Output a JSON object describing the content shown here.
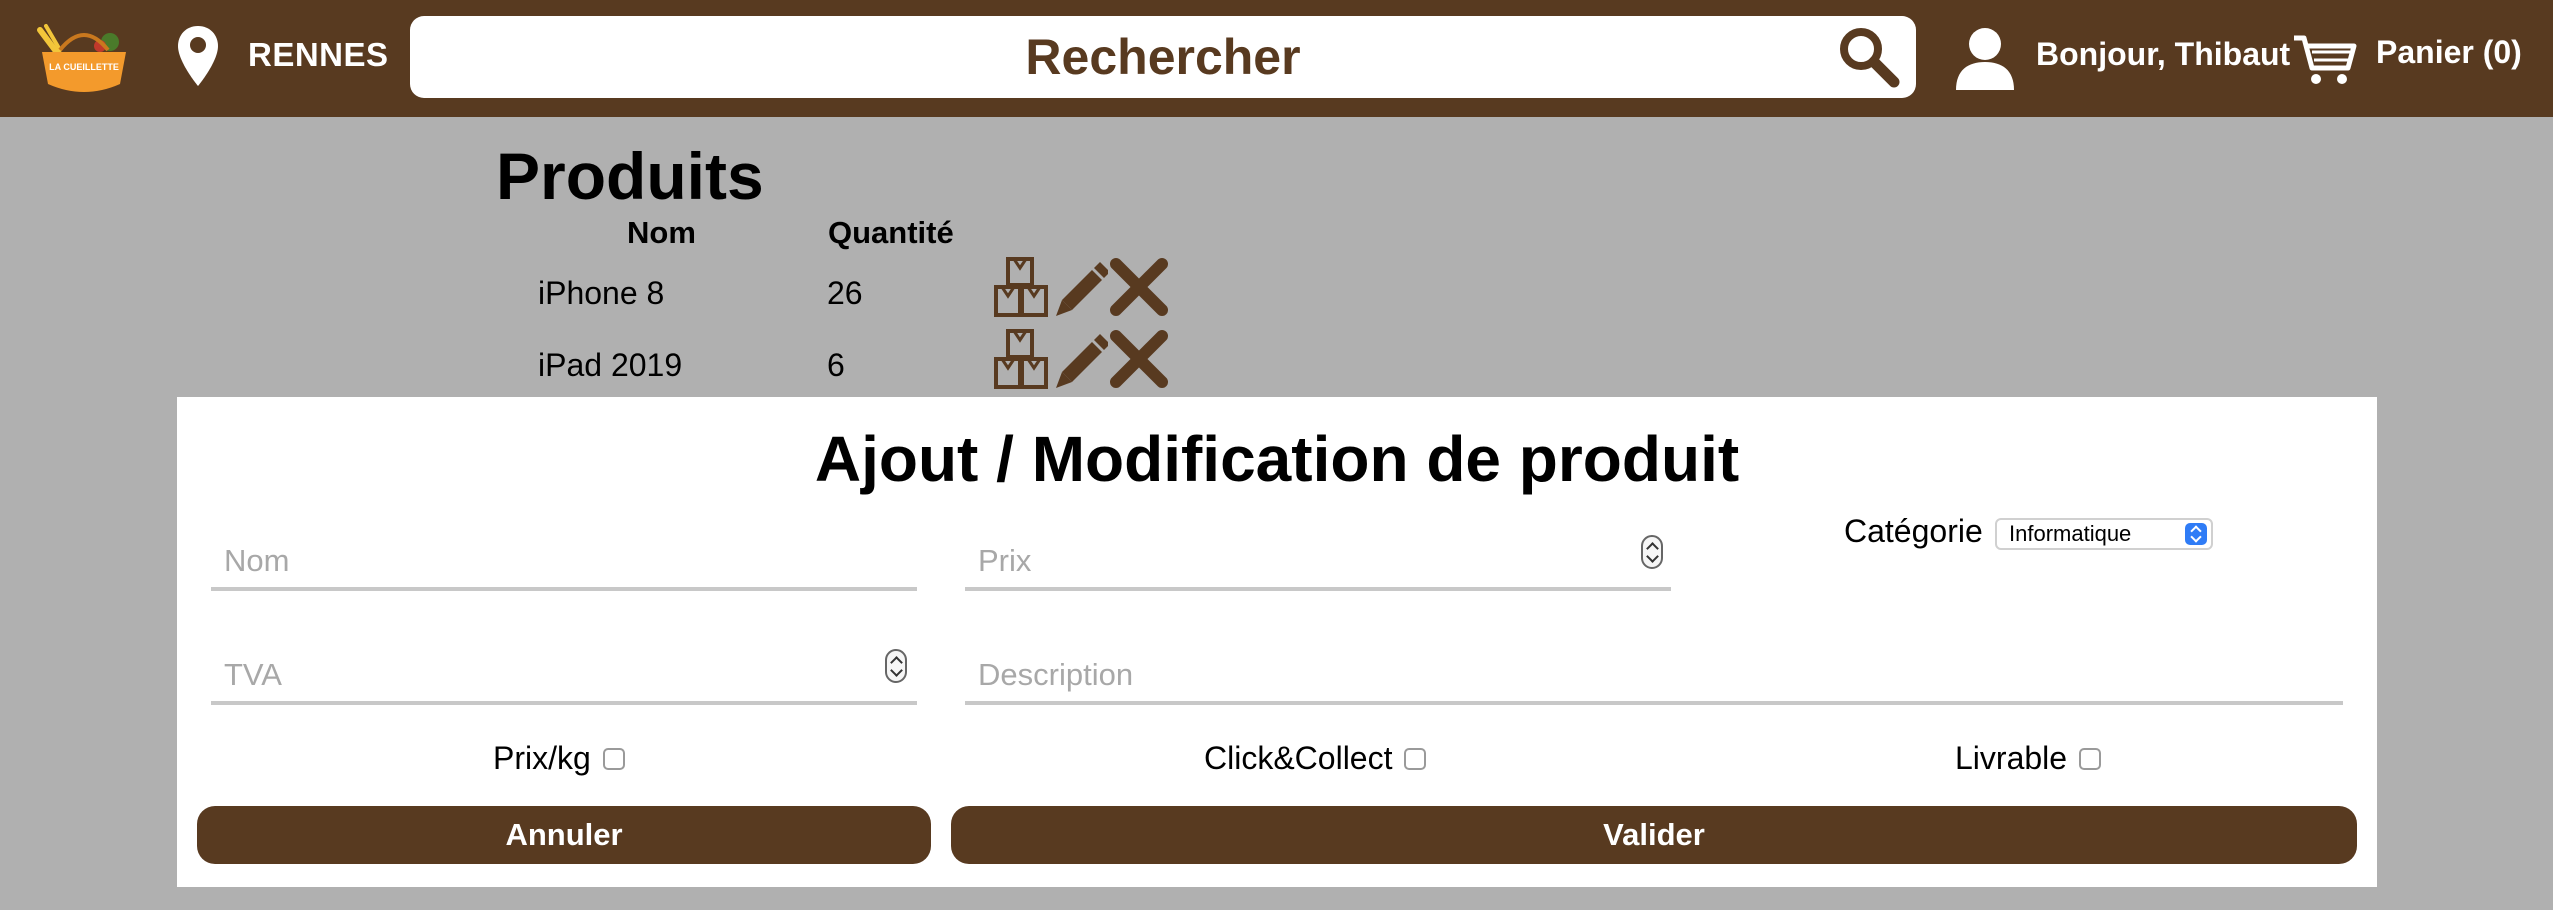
{
  "header": {
    "logo_text": "LA CUEILLETTE",
    "city": "RENNES",
    "search_placeholder": "Rechercher",
    "greeting": "Bonjour, Thibaut",
    "cart_label": "Panier (0)"
  },
  "products": {
    "title": "Produits",
    "columns": [
      "Nom",
      "Quantité"
    ],
    "rows": [
      {
        "name": "iPhone 8",
        "quantity": "26"
      },
      {
        "name": "iPad 2019",
        "quantity": "6"
      }
    ]
  },
  "form": {
    "title": "Ajout / Modification de produit",
    "fields": {
      "nom_placeholder": "Nom",
      "prix_placeholder": "Prix",
      "tva_placeholder": "TVA",
      "description_placeholder": "Description"
    },
    "category_label": "Catégorie",
    "category_value": "Informatique",
    "checkboxes": {
      "prix_kg": "Prix/kg",
      "click_collect": "Click&Collect",
      "livrable": "Livrable"
    },
    "cancel_label": "Annuler",
    "submit_label": "Valider"
  },
  "colors": {
    "brand_brown": "#583a20",
    "page_overlay": "#b0b0b0",
    "logo_orange": "#f39a2c"
  },
  "icons": [
    "location-pin-icon",
    "search-icon",
    "user-icon",
    "cart-icon",
    "boxes-icon",
    "pencil-icon",
    "delete-icon"
  ]
}
